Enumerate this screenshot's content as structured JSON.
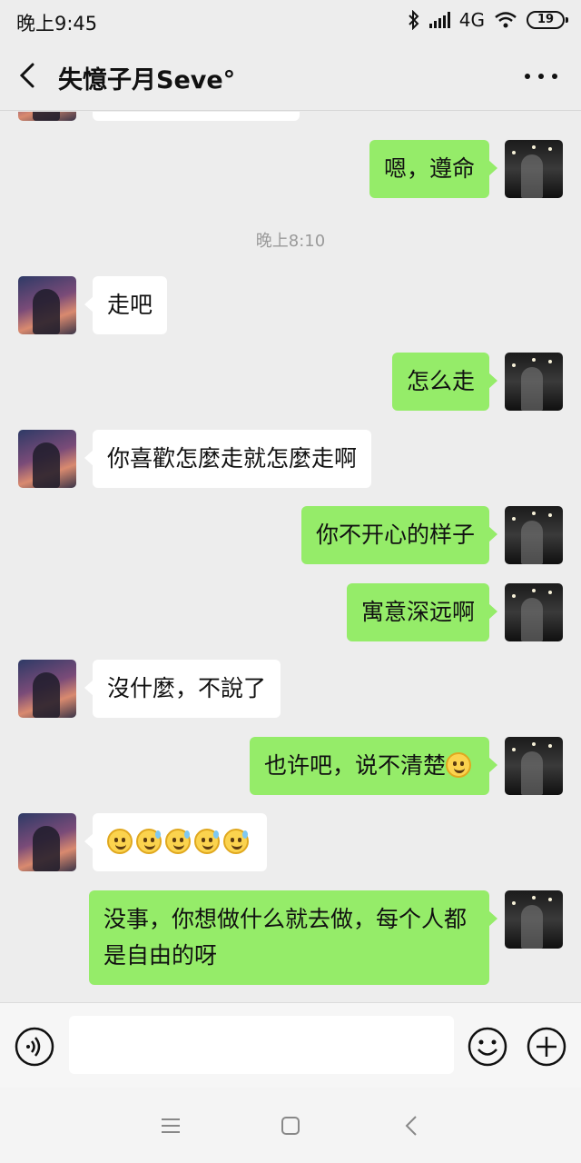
{
  "status_bar": {
    "time": "晚上9:45",
    "network": "4G",
    "battery": "19"
  },
  "header": {
    "title": "失憶子月Seve°"
  },
  "chat": {
    "timestamp": "晚上8:10",
    "messages": [
      {
        "side": "right",
        "text": "嗯，遵命"
      },
      {
        "side": "left",
        "text": "走吧"
      },
      {
        "side": "right",
        "text": "怎么走"
      },
      {
        "side": "left",
        "text": "你喜歡怎麼走就怎麼走啊"
      },
      {
        "side": "right",
        "text": "你不开心的样子"
      },
      {
        "side": "right",
        "text": "寓意深远啊"
      },
      {
        "side": "left",
        "text": "沒什麼，不說了"
      },
      {
        "side": "right",
        "text": "也许吧，说不清楚"
      },
      {
        "side": "left",
        "text": ""
      },
      {
        "side": "right",
        "text": "没事，你想做什么就去做，每个人都是自由的呀"
      }
    ]
  },
  "colors": {
    "background": "#ededed",
    "own_bubble": "#95ec69",
    "other_bubble": "#ffffff"
  },
  "icons": {
    "back": "chevron-left-icon",
    "more": "more-dots-icon",
    "voice": "voice-icon",
    "emoji": "emoji-icon",
    "add": "plus-icon"
  }
}
